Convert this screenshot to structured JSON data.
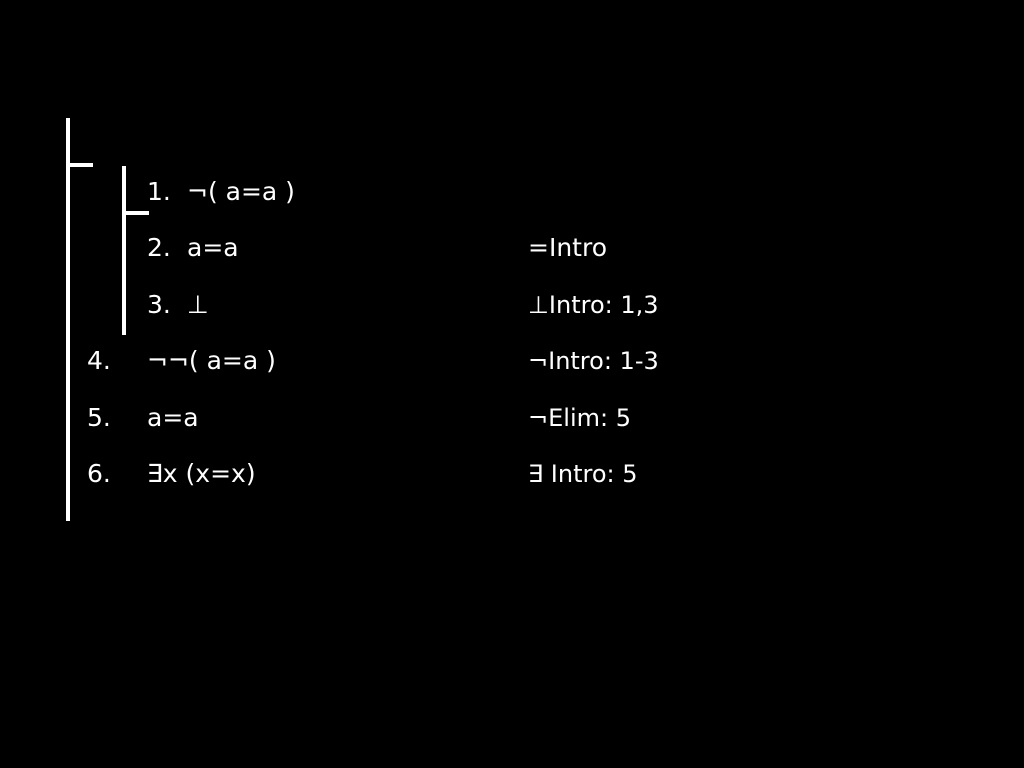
{
  "proof": {
    "lines": [
      {
        "number": "1.",
        "formula": "¬( a=a )",
        "justification": ""
      },
      {
        "number": "2.",
        "formula": "a=a",
        "justification": "=Intro"
      },
      {
        "number": "3.",
        "formula": "⊥",
        "justification": "⊥Intro: 1,3"
      },
      {
        "number": "4.",
        "formula": "¬¬( a=a )",
        "justification": "¬Intro: 1-3"
      },
      {
        "number": "5.",
        "formula": "a=a",
        "justification": "¬Elim: 5"
      },
      {
        "number": "6.",
        "formula": "∃x (x=x)",
        "justification": "∃ Intro: 5"
      }
    ]
  },
  "colors": {
    "background": "#000000",
    "foreground": "#ffffff"
  }
}
